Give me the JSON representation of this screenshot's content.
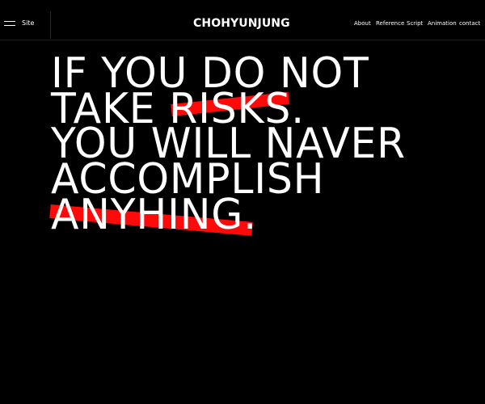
{
  "header": {
    "menu_label": "Site",
    "logo": "CHOHYUNJUNG",
    "nav": [
      "About",
      "Reference",
      "Script",
      "Animation",
      "contact"
    ]
  },
  "hero": {
    "lines": [
      "IF YOU DO NOT",
      "TAKE RISKS.",
      "YOU WILL NAVER",
      "ACCOMPLISH",
      "ANYHING."
    ],
    "highlighted_words": [
      "RISKS",
      "ANYHING"
    ]
  },
  "colors": {
    "background": "#000000",
    "text": "#ffffff",
    "highlight": "#ff0a0a"
  },
  "icons": {
    "menu": "hamburger-icon"
  }
}
